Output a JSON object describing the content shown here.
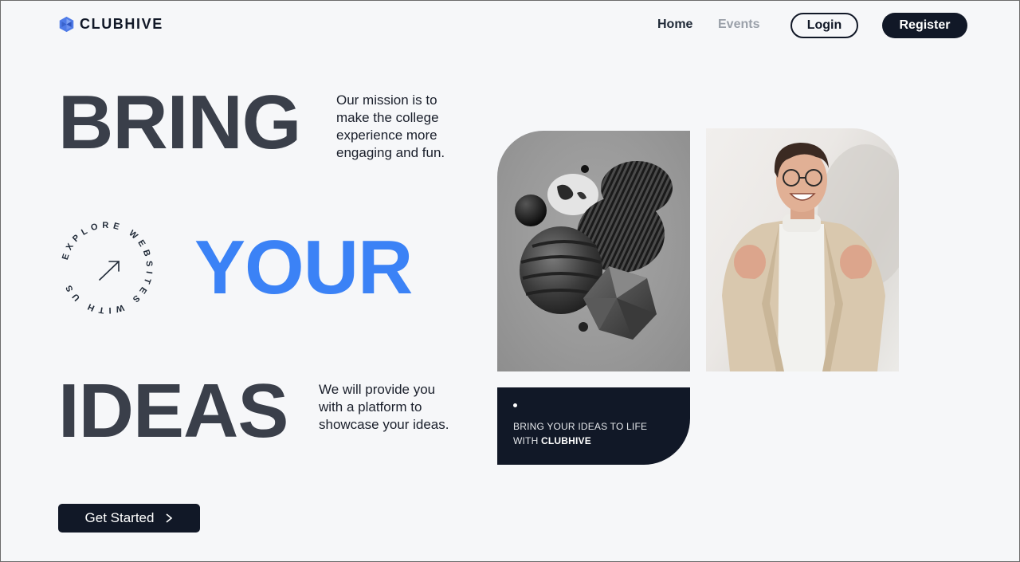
{
  "brand": {
    "name": "CLUBHIVE",
    "icon": "hexagon-logo-icon"
  },
  "nav": {
    "home": "Home",
    "events": "Events",
    "login": "Login",
    "register": "Register"
  },
  "hero": {
    "word1": "BRING",
    "word2": "YOUR",
    "word3": "IDEAS",
    "mission": "Our mission is to make the college experience more engaging and fun.",
    "platform": "We will provide you with a platform to showcase your ideas.",
    "badge_text": "EXPLORE WEBSITES WITH US",
    "cta": "Get Started"
  },
  "card": {
    "line1": "BRING YOUR IDEAS TO LIFE",
    "line2_prefix": "WITH ",
    "line2_brand": "CLUBHIVE"
  },
  "colors": {
    "accent": "#3b82f6",
    "dark": "#111827",
    "heading": "#3a3f4a",
    "background": "#f6f7f9"
  }
}
